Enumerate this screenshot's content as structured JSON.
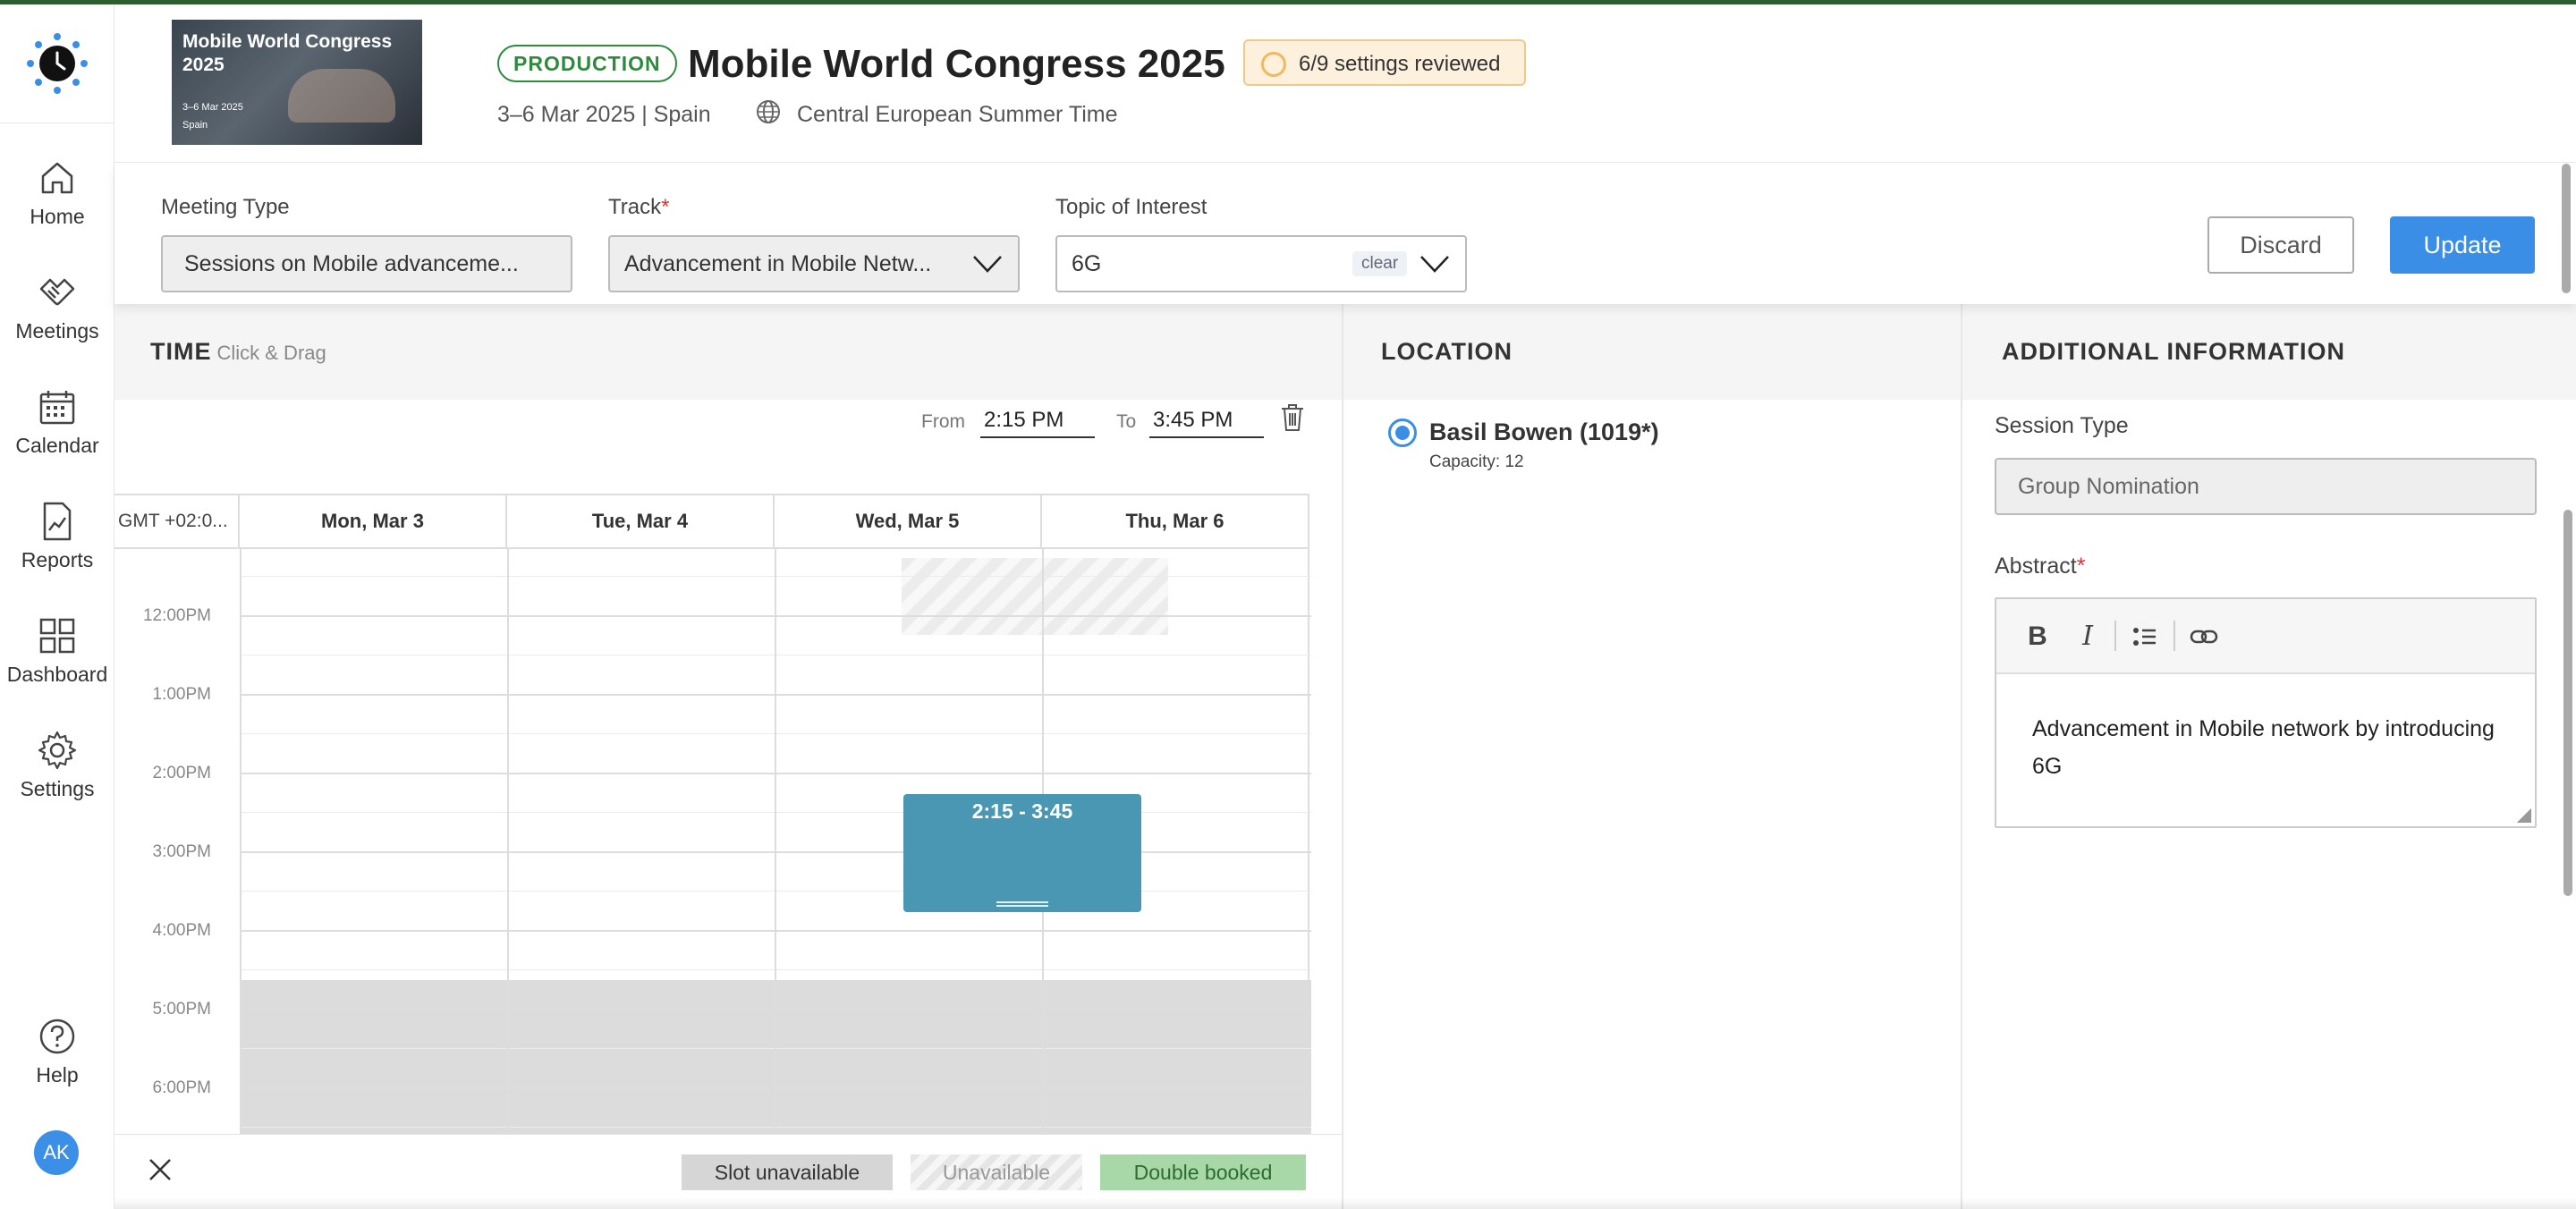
{
  "sidebar": {
    "items": [
      {
        "label": "Home",
        "icon": "home-icon"
      },
      {
        "label": "Meetings",
        "icon": "handshake-icon"
      },
      {
        "label": "Calendar",
        "icon": "calendar-icon"
      },
      {
        "label": "Reports",
        "icon": "report-icon"
      },
      {
        "label": "Dashboard",
        "icon": "dashboard-icon"
      },
      {
        "label": "Settings",
        "icon": "gear-icon"
      }
    ],
    "help": {
      "label": "Help",
      "icon": "help-icon"
    },
    "avatar_initials": "AK"
  },
  "header": {
    "banner": {
      "title": "Mobile World Congress 2025",
      "dates": "3–6 Mar 2025",
      "location": "Spain"
    },
    "env_badge": "PRODUCTION",
    "title": "Mobile World Congress 2025",
    "settings_status": "6/9 settings reviewed",
    "dates_location": "3–6 Mar 2025 | Spain",
    "timezone": "Central European Summer Time"
  },
  "filters": {
    "meeting_type": {
      "label": "Meeting Type",
      "value": "Sessions on Mobile advanceme..."
    },
    "track": {
      "label": "Track",
      "required": "*",
      "value": "Advancement in Mobile Netw..."
    },
    "topic": {
      "label": "Topic of Interest",
      "value": "6G",
      "clear": "clear"
    },
    "discard": "Discard",
    "update": "Update"
  },
  "time": {
    "title": "TIME",
    "subtitle": "Click & Drag",
    "from_label": "From",
    "from_value": "2:15 PM",
    "to_label": "To",
    "to_value": "3:45 PM",
    "timezone_col": "GMT +02:0...",
    "days": [
      "Mon, Mar 3",
      "Tue, Mar 4",
      "Wed, Mar 5",
      "Thu, Mar 6"
    ],
    "hours": [
      "12:00PM",
      "1:00PM",
      "2:00PM",
      "3:00PM",
      "4:00PM",
      "5:00PM",
      "6:00PM"
    ],
    "event_label": "2:15 - 3:45",
    "legend": {
      "slot_unavailable": "Slot unavailable",
      "unavailable": "Unavailable",
      "double_booked": "Double booked"
    }
  },
  "location": {
    "title": "LOCATION",
    "room": "Basil Bowen (1019*)",
    "capacity": "Capacity: 12"
  },
  "additional": {
    "title": "ADDITIONAL INFORMATION",
    "session_type_label": "Session Type",
    "session_type_value": "Group Nomination",
    "abstract_label": "Abstract",
    "abstract_required": "*",
    "abstract_text": "Advancement in Mobile network by introducing 6G"
  },
  "colors": {
    "accent": "#3a8ee6",
    "event": "#4a97b4",
    "production": "#2e8b3e",
    "double_booked": "#a8d8a8"
  }
}
